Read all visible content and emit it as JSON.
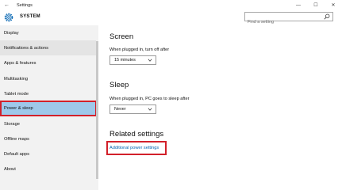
{
  "window": {
    "back_glyph": "←",
    "title": "Settings",
    "minimize_glyph": "—",
    "maximize_glyph": "☐",
    "close_glyph": "✕"
  },
  "header": {
    "section_title": "SYSTEM",
    "search_placeholder": "Find a setting"
  },
  "sidebar": {
    "items": [
      {
        "label": "Display"
      },
      {
        "label": "Notifications & actions"
      },
      {
        "label": "Apps & features"
      },
      {
        "label": "Multitasking"
      },
      {
        "label": "Tablet mode"
      },
      {
        "label": "Power & sleep"
      },
      {
        "label": "Storage"
      },
      {
        "label": "Offline maps"
      },
      {
        "label": "Default apps"
      },
      {
        "label": "About"
      }
    ],
    "selected": "Power & sleep",
    "hovered": "Notifications & actions"
  },
  "screen_section": {
    "heading": "Screen",
    "label": "When plugged in, turn off after",
    "value": "15 minutes"
  },
  "sleep_section": {
    "heading": "Sleep",
    "label": "When plugged in, PC goes to sleep after",
    "value": "Never"
  },
  "related": {
    "heading": "Related settings",
    "link": "Additional power settings"
  },
  "colors": {
    "accent": "#0063b1",
    "selection": "#9ec8ea",
    "highlight_box": "#d2202a",
    "sidebar_bg": "#f2f2f2"
  },
  "icons": {
    "header": "gear-icon",
    "search": "search-icon",
    "dropdown": "chevron-down-icon"
  }
}
